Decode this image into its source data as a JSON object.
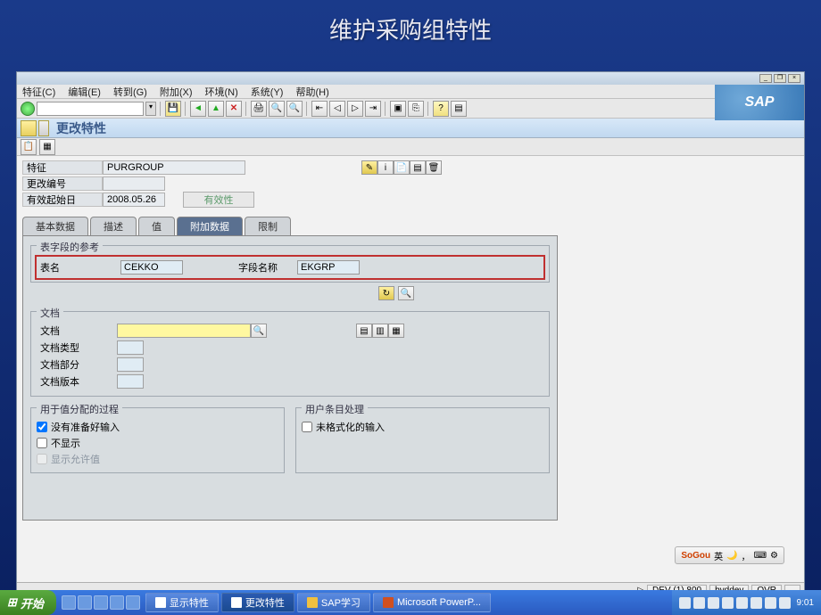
{
  "slide_title": "维护采购组特性",
  "sap_logo": "SAP",
  "menu": {
    "m1": "特征(C)",
    "m2": "编辑(E)",
    "m3": "转到(G)",
    "m4": "附加(X)",
    "m5": "环境(N)",
    "m6": "系统(Y)",
    "m7": "帮助(H)"
  },
  "page_title": "更改特性",
  "header": {
    "char_label": "特征",
    "char_value": "PURGROUP",
    "chgno_label": "更改编号",
    "chgno_value": "",
    "validfrom_label": "有效起始日",
    "validfrom_value": "2008.05.26",
    "validity_btn": "有效性"
  },
  "tabs": {
    "t1": "基本数据",
    "t2": "描述",
    "t3": "值",
    "t4": "附加数据",
    "t5": "限制"
  },
  "grp_table": {
    "title": "表字段的参考",
    "tblname_label": "表名",
    "tblname_value": "CEKKO",
    "fldname_label": "字段名称",
    "fldname_value": "EKGRP"
  },
  "grp_doc": {
    "title": "文档",
    "doc_label": "文档",
    "doctype_label": "文档类型",
    "docpart_label": "文档部分",
    "docver_label": "文档版本"
  },
  "grp_proc": {
    "title": "用于值分配的过程",
    "c1": "没有准备好输入",
    "c2": "不显示",
    "c3": "显示允许值"
  },
  "grp_user": {
    "title": "用户条目处理",
    "c1": "未格式化的输入"
  },
  "sogou": {
    "brand": "SoGou",
    "mode": "英"
  },
  "status": {
    "sys": "DEV (1) 800",
    "client": "byddev",
    "mode": "OVR"
  },
  "taskbar": {
    "start": "开始",
    "t1": "显示特性",
    "t2": "更改特性",
    "t3": "SAP学习",
    "t4": "Microsoft PowerP...",
    "time": "9:01"
  }
}
